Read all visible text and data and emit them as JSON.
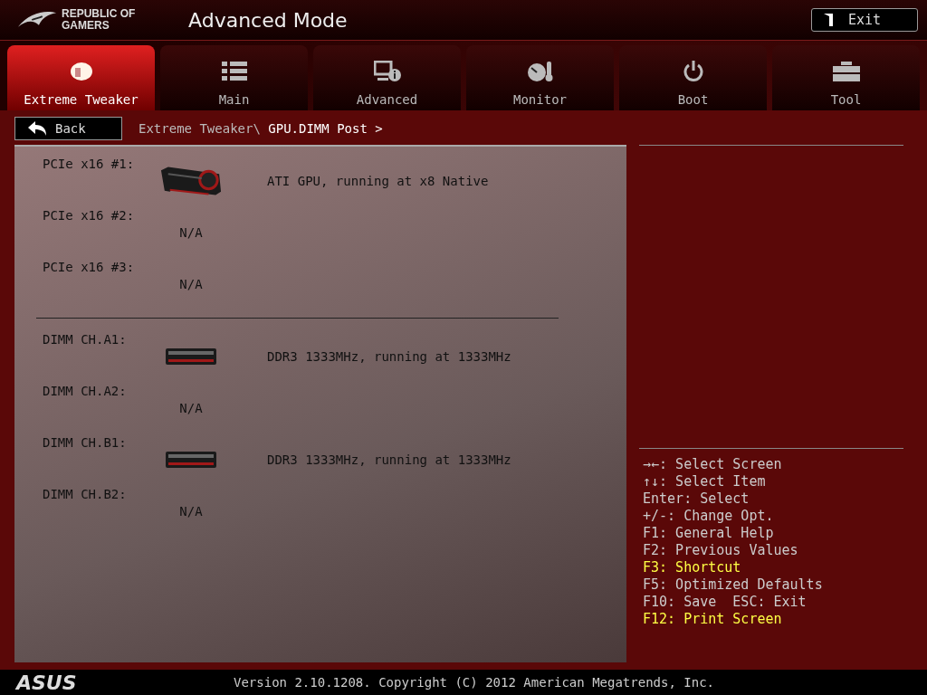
{
  "header": {
    "brand_lines": [
      "REPUBLIC OF",
      "GAMERS"
    ],
    "title": "Advanced Mode",
    "exit_button": "Exit"
  },
  "tabs": [
    {
      "label": "Extreme Tweaker",
      "selected": true
    },
    {
      "label": "Main",
      "selected": false
    },
    {
      "label": "Advanced",
      "selected": false
    },
    {
      "label": "Monitor",
      "selected": false
    },
    {
      "label": "Boot",
      "selected": false
    },
    {
      "label": "Tool",
      "selected": false
    }
  ],
  "back_button": "Back",
  "breadcrumb": {
    "path": "Extreme Tweaker\\",
    "current": "GPU.DIMM Post >"
  },
  "groups": [
    {
      "slots": [
        {
          "label": "PCIe x16 #1:",
          "kind": "gpu",
          "value": "ATI GPU, running at x8 Native"
        },
        {
          "label": "PCIe x16 #2:",
          "kind": "none",
          "value": "N/A"
        },
        {
          "label": "PCIe x16 #3:",
          "kind": "none",
          "value": "N/A"
        }
      ]
    },
    {
      "slots": [
        {
          "label": "DIMM CH.A1:",
          "kind": "dimm",
          "value": "DDR3 1333MHz, running at 1333MHz"
        },
        {
          "label": "DIMM CH.A2:",
          "kind": "none",
          "value": "N/A"
        },
        {
          "label": "DIMM CH.B1:",
          "kind": "dimm",
          "value": "DDR3 1333MHz, running at 1333MHz"
        },
        {
          "label": "DIMM CH.B2:",
          "kind": "none",
          "value": "N/A"
        }
      ]
    }
  ],
  "help": [
    {
      "text": "→←: Select Screen",
      "highlighted": false
    },
    {
      "text": "↑↓: Select Item",
      "highlighted": false
    },
    {
      "text": "Enter: Select",
      "highlighted": false
    },
    {
      "text": "+/-: Change Opt.",
      "highlighted": false
    },
    {
      "text": "F1: General Help",
      "highlighted": false
    },
    {
      "text": "F2: Previous Values",
      "highlighted": false
    },
    {
      "text": "F3: Shortcut",
      "highlighted": true
    },
    {
      "text": "F5: Optimized Defaults",
      "highlighted": false
    },
    {
      "text": "F10: Save  ESC: Exit",
      "highlighted": false
    },
    {
      "text": "F12: Print Screen",
      "highlighted": true
    }
  ],
  "footer": {
    "logo": "ASUS",
    "version": "Version 2.10.1208. Copyright (C) 2012 American Megatrends, Inc."
  }
}
